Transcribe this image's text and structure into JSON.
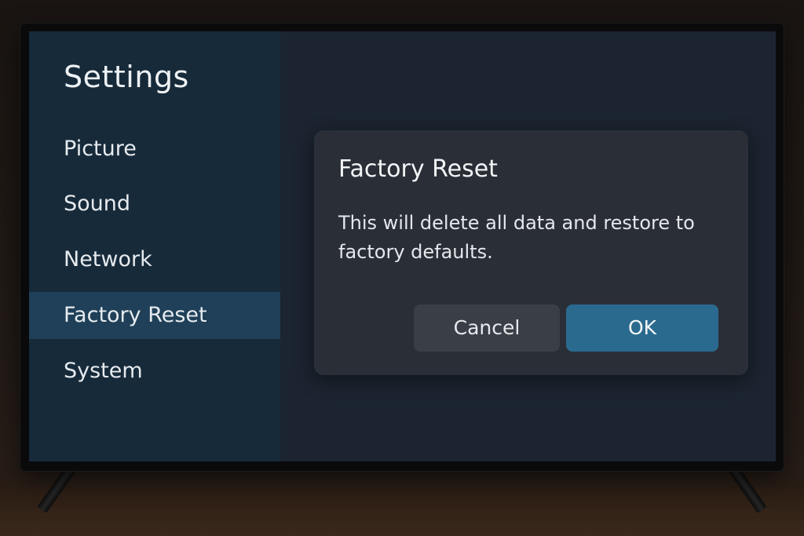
{
  "sidebar": {
    "title": "Settings",
    "items": [
      {
        "label": "Picture",
        "selected": false
      },
      {
        "label": "Sound",
        "selected": false
      },
      {
        "label": "Network",
        "selected": false
      },
      {
        "label": "Factory Reset",
        "selected": true
      },
      {
        "label": "System",
        "selected": false
      }
    ]
  },
  "dialog": {
    "title": "Factory Reset",
    "message": "This will delete all data and restore to factory defaults.",
    "cancel_label": "Cancel",
    "ok_label": "OK"
  },
  "colors": {
    "sidebar_bg": "#172a3a",
    "selected_bg": "#1f4058",
    "screen_bg": "#1b2430",
    "dialog_bg": "#2a2f37",
    "ok_button": "#2b6a8f",
    "cancel_button": "#3a3f47"
  }
}
